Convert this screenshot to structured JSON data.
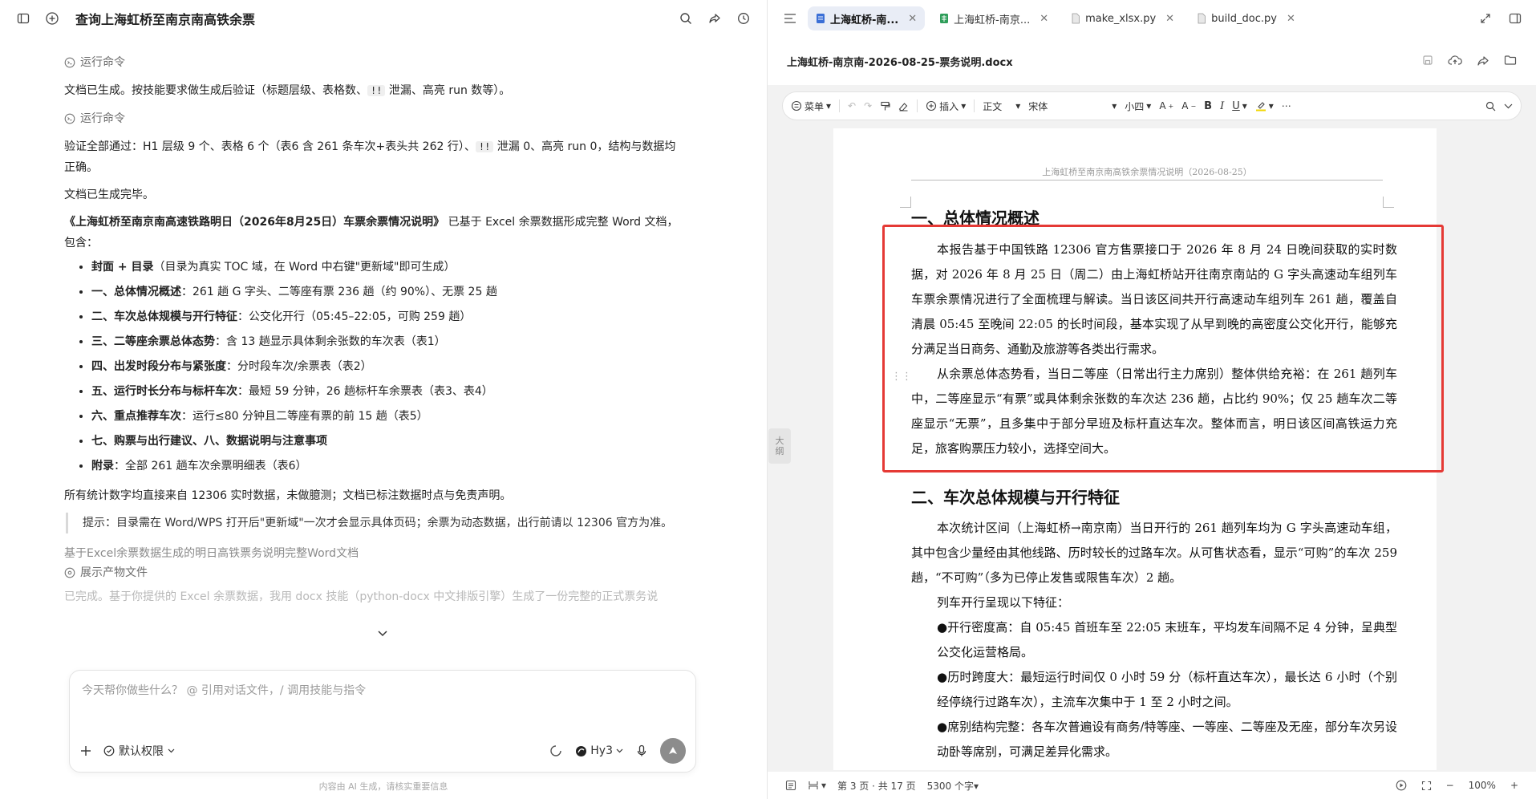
{
  "chat": {
    "title": "查询上海虹桥至南京南高铁余票",
    "run_cmd_1": "运行命令",
    "para_1": "文档已生成。按技能要求做生成后验证（标题层级、表格数、",
    "para_1_code": "!!",
    "para_1_tail": " 泄漏、高亮 run 数等）。",
    "run_cmd_2": "运行命令",
    "para_2": "验证全部通过：H1 层级 9 个、表格 6 个（表6 含 261 条车次+表头共 262 行）、",
    "para_2_code": "!!",
    "para_2_tail": " 泄漏 0、高亮 run 0，结构与数据均正确。",
    "para_3": "文档已生成完毕。",
    "para_4_bold": "《上海虹桥至南京南高速铁路明日（2026年8月25日）车票余票情况说明》",
    "para_4": " 已基于 Excel 余票数据形成完整 Word 文档，包含：",
    "deliverables": [
      {
        "head": "封面 + 目录",
        "text": "（目录为真实 TOC 域，在 Word 中右键\"更新域\"即可生成）"
      },
      {
        "head": "一、总体情况概述",
        "text": "：261 趟 G 字头、二等座有票 236 趟（约 90%）、无票 25 趟"
      },
      {
        "head": "二、车次总体规模与开行特征",
        "text": "：公交化开行（05:45–22:05，可购 259 趟）"
      },
      {
        "head": "三、二等座余票总体态势",
        "text": "：含 13 趟显示具体剩余张数的车次表（表1）"
      },
      {
        "head": "四、出发时段分布与紧张度",
        "text": "：分时段车次/余票表（表2）"
      },
      {
        "head": "五、运行时长分布与标杆车次",
        "text": "：最短 59 分钟，26 趟标杆车余票表（表3、表4）"
      },
      {
        "head": "六、重点推荐车次",
        "text": "：运行≤80 分钟且二等座有票的前 15 趟（表5）"
      },
      {
        "head": "七、购票与出行建议、八、数据说明与注意事项",
        "text": ""
      },
      {
        "head": "附录",
        "text": "：全部 261 趟车次余票明细表（表6）"
      }
    ],
    "para_5": "所有统计数字均直接来自 12306 实时数据，未做臆测；文档已标注数据时点与免责声明。",
    "tip": "提示：目录需在 Word/WPS 打开后\"更新域\"一次才会显示具体页码；余票为动态数据，出行前请以 12306 官方为准。",
    "summary": "基于Excel余票数据生成的明日高铁票务说明完整Word文档",
    "show_output": "展示产物文件",
    "faded_text": "已完成。基于你提供的 Excel 余票数据，我用 docx 技能（python-docx 中文排版引擎）生成了一份完整的正式票务说",
    "input_placeholder": "今天帮你做些什么？ @ 引用对话文件，/ 调用技能与指令",
    "permission": "默认权限",
    "model": "Hy3",
    "disclaimer": "内容由 AI 生成，请核实重要信息"
  },
  "editor": {
    "tabs": [
      {
        "label": "上海虹桥-南...",
        "active": true,
        "icon": "doc-icon"
      },
      {
        "label": "上海虹桥-南京...",
        "active": false,
        "icon": "sheet-icon"
      },
      {
        "label": "make_xlsx.py",
        "active": false,
        "icon": "file-icon"
      },
      {
        "label": "build_doc.py",
        "active": false,
        "icon": "file-icon"
      }
    ],
    "doc_name": "上海虹桥-南京南-2026-08-25-票务说明.docx",
    "toolbar": {
      "menu": "菜单",
      "insert": "插入",
      "style": "正文",
      "font": "宋体",
      "size": "小四"
    },
    "page_header": "上海虹桥至南京南高铁余票情况说明（2026-08-25）",
    "h1_1": "一、总体情况概述",
    "s1_p1": "本报告基于中国铁路 12306 官方售票接口于 2026 年 8 月 24 日晚间获取的实时数据，对 2026 年 8 月 25 日（周二）由上海虹桥站开往南京南站的 G 字头高速动车组列车车票余票情况进行了全面梳理与解读。当日该区间共开行高速动车组列车 261 趟，覆盖自清晨 05:45 至晚间 22:05 的长时间段，基本实现了从早到晚的高密度公交化开行，能够充分满足当日商务、通勤及旅游等各类出行需求。",
    "s1_p2": "从余票总体态势看，当日二等座（日常出行主力席别）整体供给充裕：在 261 趟列车中，二等座显示“有票”或具体剩余张数的车次达 236 趟，占比约 90%；仅 25 趟车次二等座显示“无票”，且多集中于部分早班及标杆直达车次。整体而言，明日该区间高铁运力充足，旅客购票压力较小，选择空间大。",
    "h1_2": "二、车次总体规模与开行特征",
    "s2_p1": "本次统计区间（上海虹桥→南京南）当日开行的 261 趟列车均为 G 字头高速动车组，其中包含少量经由其他线路、历时较长的过路车次。从可售状态看，显示“可购”的车次 259 趟，“不可购”（多为已停止发售或限售车次）2 趟。",
    "s2_p2": "列车开行呈现以下特征：",
    "s2_b1": "●开行密度高：自 05:45 首班车至 22:05 末班车，平均发车间隔不足 4 分钟，呈典型公交化运营格局。",
    "s2_b2": "●历时跨度大：最短运行时间仅 0 小时 59 分（标杆直达车次），最长达 6 小时（个别经停绕行过路车次），主流车次集中于 1 至 2 小时之间。",
    "s2_b3": "●席别结构完整：各车次普遍设有商务/特等座、一等座、二等座及无座，部分车次另设动卧等席别，可满足差异化需求。",
    "outline_label_1": "大",
    "outline_label_2": "纲",
    "status": {
      "page": "第 3 页 · 共 17 页",
      "words": "5300 个字",
      "zoom": "100%"
    }
  }
}
